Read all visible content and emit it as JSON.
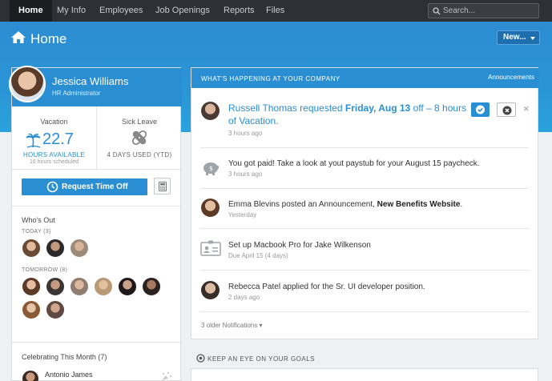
{
  "nav": {
    "items": [
      "Home",
      "My Info",
      "Employees",
      "Job Openings",
      "Reports",
      "Files"
    ],
    "search_placeholder": "Search..."
  },
  "header": {
    "title": "Home",
    "new_button": "New..."
  },
  "profile": {
    "name": "Jessica Williams",
    "role": "HR Administrator"
  },
  "time_off": {
    "vacation": {
      "label": "Vacation",
      "hours": "22.7",
      "available_label": "HOURS AVAILABLE",
      "scheduled": "16 hours scheduled"
    },
    "sick": {
      "label": "Sick Leave",
      "used": "4 DAYS USED (YTD)"
    },
    "request_button": "Request Time Off"
  },
  "whos_out": {
    "title": "Who's Out",
    "today_label": "TODAY (3)",
    "tomorrow_label": "TOMORROW (8)"
  },
  "celebrating": {
    "title": "Celebrating This Month (7)",
    "first_name": "Antonio James"
  },
  "happening": {
    "title": "WHAT'S HAPPENING AT YOUR COMPANY",
    "link": "Announcements",
    "request": {
      "name": "Russell Thomas",
      "verb": "requested",
      "date": "Friday, Aug 13",
      "rest": "off – 8 hours of Vacation.",
      "time": "3 hours ago"
    },
    "items": [
      {
        "text": "You got paid! Take a look at yout paystub for your August 15 paycheck.",
        "time": "3 hours ago",
        "icon": "piggy-bank-icon"
      },
      {
        "text_pre": "Emma Blevins posted an Announcement, ",
        "text_bold": "New Benefits Website",
        "text_post": ".",
        "time": "Yesterday",
        "icon": "avatar"
      },
      {
        "text": "Set up Macbook Pro for Jake Wilkenson",
        "time": "Due April 15 (4 days)",
        "icon": "id-card-icon"
      },
      {
        "text": "Rebecca Patel applied for the Sr. UI developer position.",
        "time": "2 days ago",
        "icon": "avatar"
      }
    ],
    "older": "3 older Notifications ▾"
  },
  "goals": {
    "title": "KEEP AN EYE ON YOUR GOALS"
  },
  "colors": {
    "nav_bg": "#2d3034",
    "accent": "#2a8ed2",
    "page_bg": "#eef0f1"
  }
}
